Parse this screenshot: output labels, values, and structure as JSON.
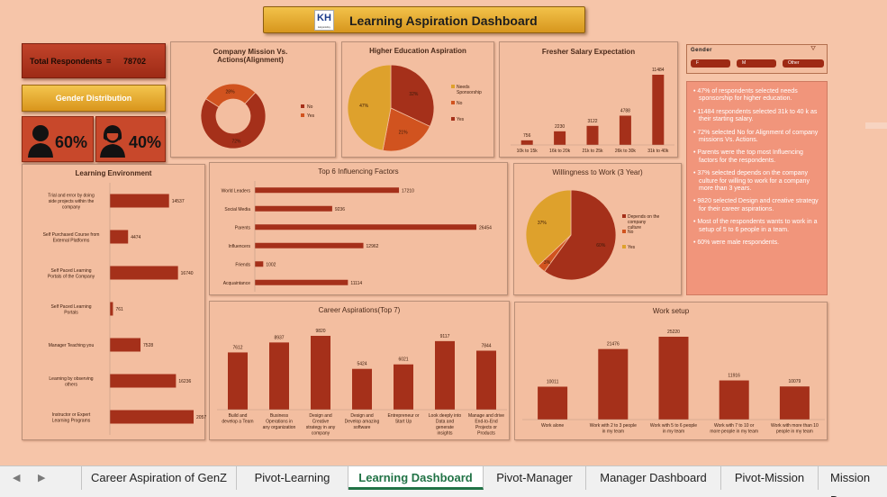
{
  "header": {
    "title": "Learning Aspiration Dashboard",
    "logo_text": "KH",
    "logo_sub": "kalyanidsy"
  },
  "total": {
    "label": "Total Respondents",
    "eq": "=",
    "value": "78702"
  },
  "gender_distribution": {
    "label": "Gender Distribution",
    "male_pct": "60%",
    "female_pct": "40%",
    "male_icon": "male-user-icon",
    "female_icon": "female-user-icon"
  },
  "gender_slicer": {
    "label": "Gender",
    "items": [
      "F",
      "M",
      "Other"
    ],
    "clear_icon": "clear-filter-icon"
  },
  "insights": [
    "• 47% of respondents selected needs sponsorship for higher education.",
    "• 11484 respondents selected 31k to 40 k as their starting salary.",
    "• 72% selected No for Alignment of company missions Vs. Actions.",
    "• Parents were the top most Influencing factors for the respondents.",
    "• 37% selected depends on the company culture for willing to work for a company more than 3 years.",
    "• 9820 selected Design and creative strategy for their career aspirations.",
    "• Most of the respondents wants to work in a setup of 5 to 6 people in a team.",
    "• 60% were male respondents."
  ],
  "colors": {
    "dark": "#a5301a",
    "mid": "#d1531f",
    "gold": "#dea12c",
    "bg": "#f6c5a9"
  },
  "chart_data": [
    {
      "id": "mission",
      "type": "pie",
      "donut": true,
      "title": "Company Mission Vs. Actions(Alignment)",
      "categories": [
        "No",
        "Yes"
      ],
      "values": [
        72,
        28
      ],
      "labels": [
        "72%",
        "28%"
      ],
      "legend": "right"
    },
    {
      "id": "higher_ed",
      "type": "pie",
      "title": "Higher Education Aspiration",
      "categories": [
        "Needs Sponsorship",
        "No",
        "Yes"
      ],
      "legend_labels": [
        "Needs Sponsorship",
        "No",
        "Yes"
      ],
      "values": [
        47,
        21,
        32
      ],
      "labels": [
        "47%",
        "21%",
        "32%"
      ],
      "legend": "right"
    },
    {
      "id": "salary",
      "type": "bar",
      "title": "Fresher Salary Expectation",
      "categories": [
        "10k to 15k",
        "16k to 20k",
        "21k to 25k",
        "26k to 30k",
        "31k to 40k"
      ],
      "values": [
        756,
        2230,
        3122,
        4788,
        11484
      ],
      "value_labels": [
        "756",
        "2230",
        "3122",
        "4788",
        "11484"
      ]
    },
    {
      "id": "learning_env",
      "type": "bar",
      "orientation": "horizontal",
      "title": "Learning Environment",
      "categories": [
        "Trial and error by doing side projects within the company",
        "Self Purchased Course from External Platforms",
        "Self Paced Learning Portals of the Company",
        "Self Paced Learning Portals",
        "Manager Teaching you",
        "Learning by observing others",
        "Instructor or Expert Learning Programs"
      ],
      "values": [
        14537,
        4474,
        16740,
        761,
        7528,
        16236,
        20576
      ],
      "value_labels": [
        "14537",
        "4474",
        "16740",
        "761",
        "7528",
        "16236",
        "20576"
      ]
    },
    {
      "id": "influencing",
      "type": "bar",
      "orientation": "horizontal",
      "title": "Top 6 Influencing Factors",
      "categories": [
        "World Leaders",
        "Social Media",
        "Parents",
        "Influencers",
        "Friends",
        "Acquaintance"
      ],
      "values": [
        17210,
        9236,
        26454,
        12962,
        1002,
        11114
      ],
      "value_labels": [
        "17210",
        "9236",
        "26454",
        "12962",
        "1002",
        "11114"
      ]
    },
    {
      "id": "willingness",
      "type": "pie",
      "title": "Willingness to Work (3 Year)",
      "categories": [
        "Depends on the company culture",
        "No",
        "Yes"
      ],
      "values": [
        37,
        3,
        60
      ],
      "labels": [
        "37%",
        "3%",
        "60%"
      ],
      "legend": "right"
    },
    {
      "id": "career",
      "type": "bar",
      "title": "Career Aspirations(Top 7)",
      "categories": [
        "Build and develop a Team",
        "Business Operations in any organization",
        "Design and Creative strategy in any company",
        "Design and Develop amazing software",
        "Entrepreneur or Start Up",
        "Look deeply into Data and generate insights",
        "Manage and drive End-to-End Projects or Products"
      ],
      "values": [
        7612,
        8937,
        9820,
        5424,
        6021,
        9117,
        7844
      ],
      "value_labels": [
        "7612",
        "8937",
        "9820",
        "5424",
        "6021",
        "9117",
        "7844"
      ]
    },
    {
      "id": "work_setup",
      "type": "bar",
      "title": "Work setup",
      "categories": [
        "Work alone",
        "Work with 2 to 3 people in my team",
        "Work with 5 to 6 people in my team",
        "Work with 7 to 10 or more people in my team",
        "Work with more than 10 people in my team"
      ],
      "values": [
        10011,
        21476,
        25220,
        11916,
        10079
      ],
      "value_labels": [
        "10011",
        "21476",
        "25220",
        "11916",
        "10079"
      ]
    }
  ],
  "tabs": [
    "Career Aspiration of GenZ",
    "Pivot-Learning",
    "Learning Dashboard",
    "Pivot-Manager",
    "Manager Dashboard",
    "Pivot-Mission",
    "Mission Da"
  ],
  "active_tab": "Learning Dashboard"
}
